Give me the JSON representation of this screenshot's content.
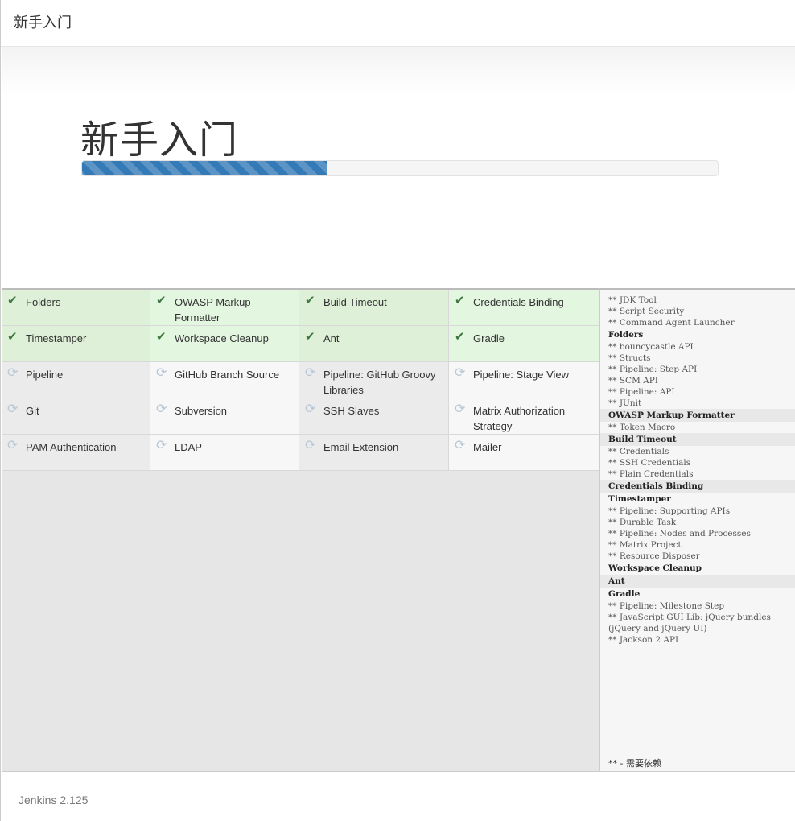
{
  "window": {
    "title": "新手入门"
  },
  "hero": {
    "heading": "新手入门",
    "progress_fraction": 0.386
  },
  "plugins": [
    {
      "name": "Folders",
      "status": "installed",
      "icon": "check-icon"
    },
    {
      "name": "OWASP Markup Formatter",
      "status": "installed",
      "icon": "check-icon"
    },
    {
      "name": "Build Timeout",
      "status": "installed",
      "icon": "check-icon"
    },
    {
      "name": "Credentials Binding",
      "status": "installed",
      "icon": "check-icon"
    },
    {
      "name": "Timestamper",
      "status": "installed",
      "icon": "check-icon"
    },
    {
      "name": "Workspace Cleanup",
      "status": "installed",
      "icon": "check-icon"
    },
    {
      "name": "Ant",
      "status": "installed",
      "icon": "check-icon"
    },
    {
      "name": "Gradle",
      "status": "installed",
      "icon": "check-icon"
    },
    {
      "name": "Pipeline",
      "status": "pending",
      "icon": "refresh-icon"
    },
    {
      "name": "GitHub Branch Source",
      "status": "pending",
      "icon": "refresh-icon"
    },
    {
      "name": "Pipeline: GitHub Groovy Libraries",
      "status": "pending",
      "icon": "refresh-icon"
    },
    {
      "name": "Pipeline: Stage View",
      "status": "pending",
      "icon": "refresh-icon"
    },
    {
      "name": "Git",
      "status": "pending",
      "icon": "refresh-icon"
    },
    {
      "name": "Subversion",
      "status": "pending",
      "icon": "refresh-icon"
    },
    {
      "name": "SSH Slaves",
      "status": "pending",
      "icon": "refresh-icon"
    },
    {
      "name": "Matrix Authorization Strategy",
      "status": "pending",
      "icon": "refresh-icon"
    },
    {
      "name": "PAM Authentication",
      "status": "pending",
      "icon": "refresh-icon"
    },
    {
      "name": "LDAP",
      "status": "pending",
      "icon": "refresh-icon"
    },
    {
      "name": "Email Extension",
      "status": "pending",
      "icon": "refresh-icon"
    },
    {
      "name": "Mailer",
      "status": "pending",
      "icon": "refresh-icon"
    }
  ],
  "log": {
    "lines": [
      {
        "text": "** JDK Tool",
        "kind": "dep"
      },
      {
        "text": "** Script Security",
        "kind": "dep"
      },
      {
        "text": "** Command Agent Launcher",
        "kind": "dep"
      },
      {
        "text": "Folders",
        "kind": "done"
      },
      {
        "text": "** bouncycastle API",
        "kind": "dep"
      },
      {
        "text": "** Structs",
        "kind": "dep"
      },
      {
        "text": "** Pipeline: Step API",
        "kind": "dep"
      },
      {
        "text": "** SCM API",
        "kind": "dep"
      },
      {
        "text": "** Pipeline: API",
        "kind": "dep"
      },
      {
        "text": "** JUnit",
        "kind": "dep"
      },
      {
        "text": "OWASP Markup Formatter",
        "kind": "done-shade"
      },
      {
        "text": "** Token Macro",
        "kind": "dep"
      },
      {
        "text": "Build Timeout",
        "kind": "done-shade"
      },
      {
        "text": "** Credentials",
        "kind": "dep"
      },
      {
        "text": "** SSH Credentials",
        "kind": "dep"
      },
      {
        "text": "** Plain Credentials",
        "kind": "dep"
      },
      {
        "text": "Credentials Binding",
        "kind": "done-shade"
      },
      {
        "text": "Timestamper",
        "kind": "done"
      },
      {
        "text": "** Pipeline: Supporting APIs",
        "kind": "dep"
      },
      {
        "text": "** Durable Task",
        "kind": "dep"
      },
      {
        "text": "** Pipeline: Nodes and Processes",
        "kind": "dep"
      },
      {
        "text": "** Matrix Project",
        "kind": "dep"
      },
      {
        "text": "** Resource Disposer",
        "kind": "dep"
      },
      {
        "text": "Workspace Cleanup",
        "kind": "done"
      },
      {
        "text": "Ant",
        "kind": "done-shade"
      },
      {
        "text": "Gradle",
        "kind": "done"
      },
      {
        "text": "** Pipeline: Milestone Step",
        "kind": "dep"
      },
      {
        "text": "** JavaScript GUI Lib: jQuery bundles (jQuery and jQuery UI)",
        "kind": "dep"
      },
      {
        "text": "** Jackson 2 API",
        "kind": "dep"
      }
    ],
    "footer_note": "** - 需要依赖"
  },
  "footer": {
    "version": "Jenkins 2.125"
  },
  "colors": {
    "installed_bg": "#dff0d8",
    "pending_bg": "#ebebeb",
    "progress": "#337ab7",
    "check": "#3c763d"
  }
}
